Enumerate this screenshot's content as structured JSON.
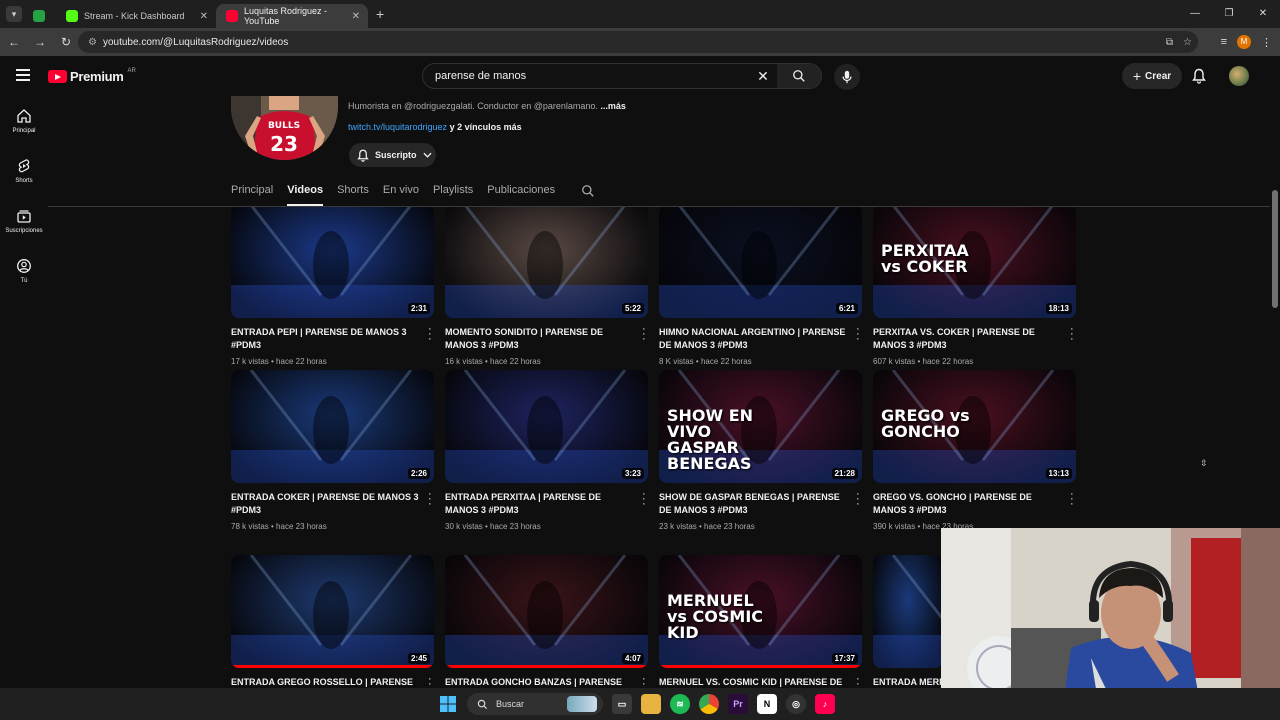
{
  "browser": {
    "tabs": [
      {
        "label": ""
      },
      {
        "label": "Stream - Kick Dashboard"
      },
      {
        "label": "Luquitas Rodriguez - YouTube"
      }
    ],
    "url": "youtube.com/@LuquitasRodriguez/videos",
    "profile_initial": "M"
  },
  "header": {
    "logo_text": "Premium",
    "logo_region": "AR",
    "search_value": "parense de manos",
    "create_label": "Crear"
  },
  "leftnav": [
    {
      "label": "Principal",
      "icon": "home-icon"
    },
    {
      "label": "Shorts",
      "icon": "shorts-icon"
    },
    {
      "label": "Suscripciones",
      "icon": "subscriptions-icon"
    },
    {
      "label": "Tú",
      "icon": "you-icon"
    }
  ],
  "channel": {
    "description": "Humorista en @rodriguezgalati.  Conductor en @parenlamano. ",
    "more": "...más",
    "link": "twitch.tv/luquitarodriguez",
    "more_links": " y 2 vínculos más",
    "subscribed_label": "Suscripto",
    "avatar_text": "23",
    "avatar_team": "BULLS"
  },
  "tabs": [
    "Principal",
    "Videos",
    "Shorts",
    "En vivo",
    "Playlists",
    "Publicaciones"
  ],
  "active_tab": "Videos",
  "videos": [
    {
      "title": "ENTRADA PEPI | PARENSE DE MANOS 3 #PDM3",
      "views": "17 k vistas",
      "time": "hace 22 horas",
      "duration": "2:31",
      "thumb_text": "",
      "bg": "#1b3a8a"
    },
    {
      "title": "MOMENTO SONIDITO | PARENSE DE MANOS 3 #PDM3",
      "views": "16 k vistas",
      "time": "hace 22 horas",
      "duration": "5:22",
      "thumb_text": "",
      "bg": "#5a4a44"
    },
    {
      "title": "HIMNO NACIONAL ARGENTINO | PARENSE DE MANOS 3 #PDM3",
      "views": "8 K vistas",
      "time": "hace 22 horas",
      "duration": "6:21",
      "thumb_text": "",
      "bg": "#0b1022"
    },
    {
      "title": "PERXITAA vs. COKER | PARENSE DE MANOS 3 #PDM3",
      "views": "607 k vistas",
      "time": "hace 22 horas",
      "duration": "18:13",
      "thumb_text": "PERXITAA vs COKER",
      "bg": "#4a1020"
    },
    {
      "title": "ENTRADA COKER | PARENSE DE MANOS 3 #PDM3",
      "views": "78 k vistas",
      "time": "hace 23 horas",
      "duration": "2:26",
      "thumb_text": "",
      "bg": "#1a3a7a"
    },
    {
      "title": "ENTRADA PERXITAA | PARENSE DE MANOS 3 #PDM3",
      "views": "30 k vistas",
      "time": "hace 23 horas",
      "duration": "3:23",
      "thumb_text": "",
      "bg": "#1e2460"
    },
    {
      "title": "SHOW DE GASPAR BENEGAS | PARENSE DE MANOS 3 #PDM3",
      "views": "23 k vistas",
      "time": "hace 23 horas",
      "duration": "21:28",
      "thumb_text": "SHOW EN VIVO GASPAR BENEGAS",
      "bg": "#4a1028"
    },
    {
      "title": "GREGO vs. GONCHO | PARENSE DE MANOS 3 #PDM3",
      "views": "390 k vistas",
      "time": "hace 23 horas",
      "duration": "13:13",
      "thumb_text": "GREGO vs GONCHO",
      "bg": "#4a1020"
    },
    {
      "title": "ENTRADA GREGO ROSSELLO | PARENSE DE",
      "views": "",
      "time": "",
      "duration": "2:45",
      "thumb_text": "",
      "bg": "#1e3a70"
    },
    {
      "title": "ENTRADA GONCHO BANZAS | PARENSE DE",
      "views": "",
      "time": "",
      "duration": "4:07",
      "thumb_text": "",
      "bg": "#3a1418"
    },
    {
      "title": "MERNUEL vs. COSMIC KID | PARENSE DE",
      "views": "",
      "time": "",
      "duration": "17:37",
      "thumb_text": "MERNUEL vs COSMIC KID",
      "bg": "#4a1028"
    },
    {
      "title": "ENTRADA MERN",
      "views": "",
      "time": "",
      "duration": "",
      "thumb_text": "",
      "bg": "#1a3a7a"
    }
  ],
  "taskbar": {
    "search_placeholder": "Buscar"
  },
  "colors": {
    "accent_red": "#ff0033",
    "link_blue": "#3ea6ff",
    "bg": "#0f0f0f"
  }
}
